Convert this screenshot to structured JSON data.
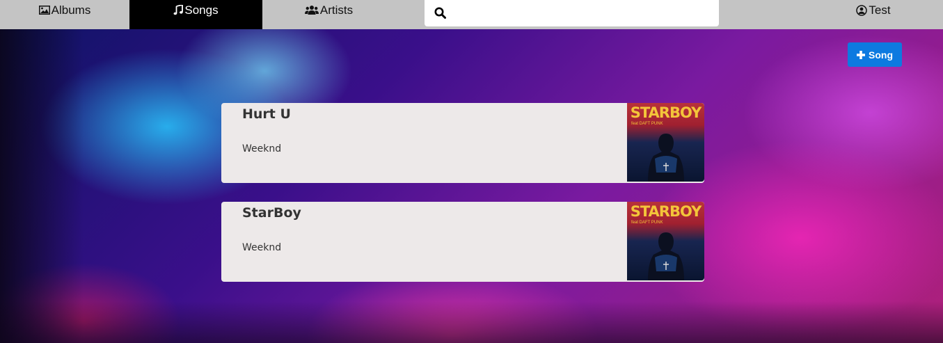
{
  "nav": {
    "albums_label": "Albums",
    "songs_label": "Songs",
    "artists_label": "Artists",
    "user_label": "Test",
    "active": "Songs"
  },
  "search": {
    "placeholder": "",
    "value": ""
  },
  "actions": {
    "add_song_label": "Song"
  },
  "songs": [
    {
      "title": "Hurt U",
      "artist": "Weeknd",
      "cover_text": "STARBOY",
      "cover_subtext": "feat DAFT PUNK"
    },
    {
      "title": "StarBoy",
      "artist": "Weeknd",
      "cover_text": "STARBOY",
      "cover_subtext": "feat DAFT PUNK"
    }
  ],
  "colors": {
    "nav_bg": "#c4c4c4",
    "nav_active_bg": "#000000",
    "button_primary": "#0d7ae0",
    "card_bg": "#ede9e9",
    "cover_text": "#f3c53a"
  },
  "icons": {
    "albums": "image-icon",
    "songs": "music-icon",
    "artists": "users-icon",
    "user": "user-circle-icon",
    "search": "search-icon",
    "add": "plus-icon"
  }
}
